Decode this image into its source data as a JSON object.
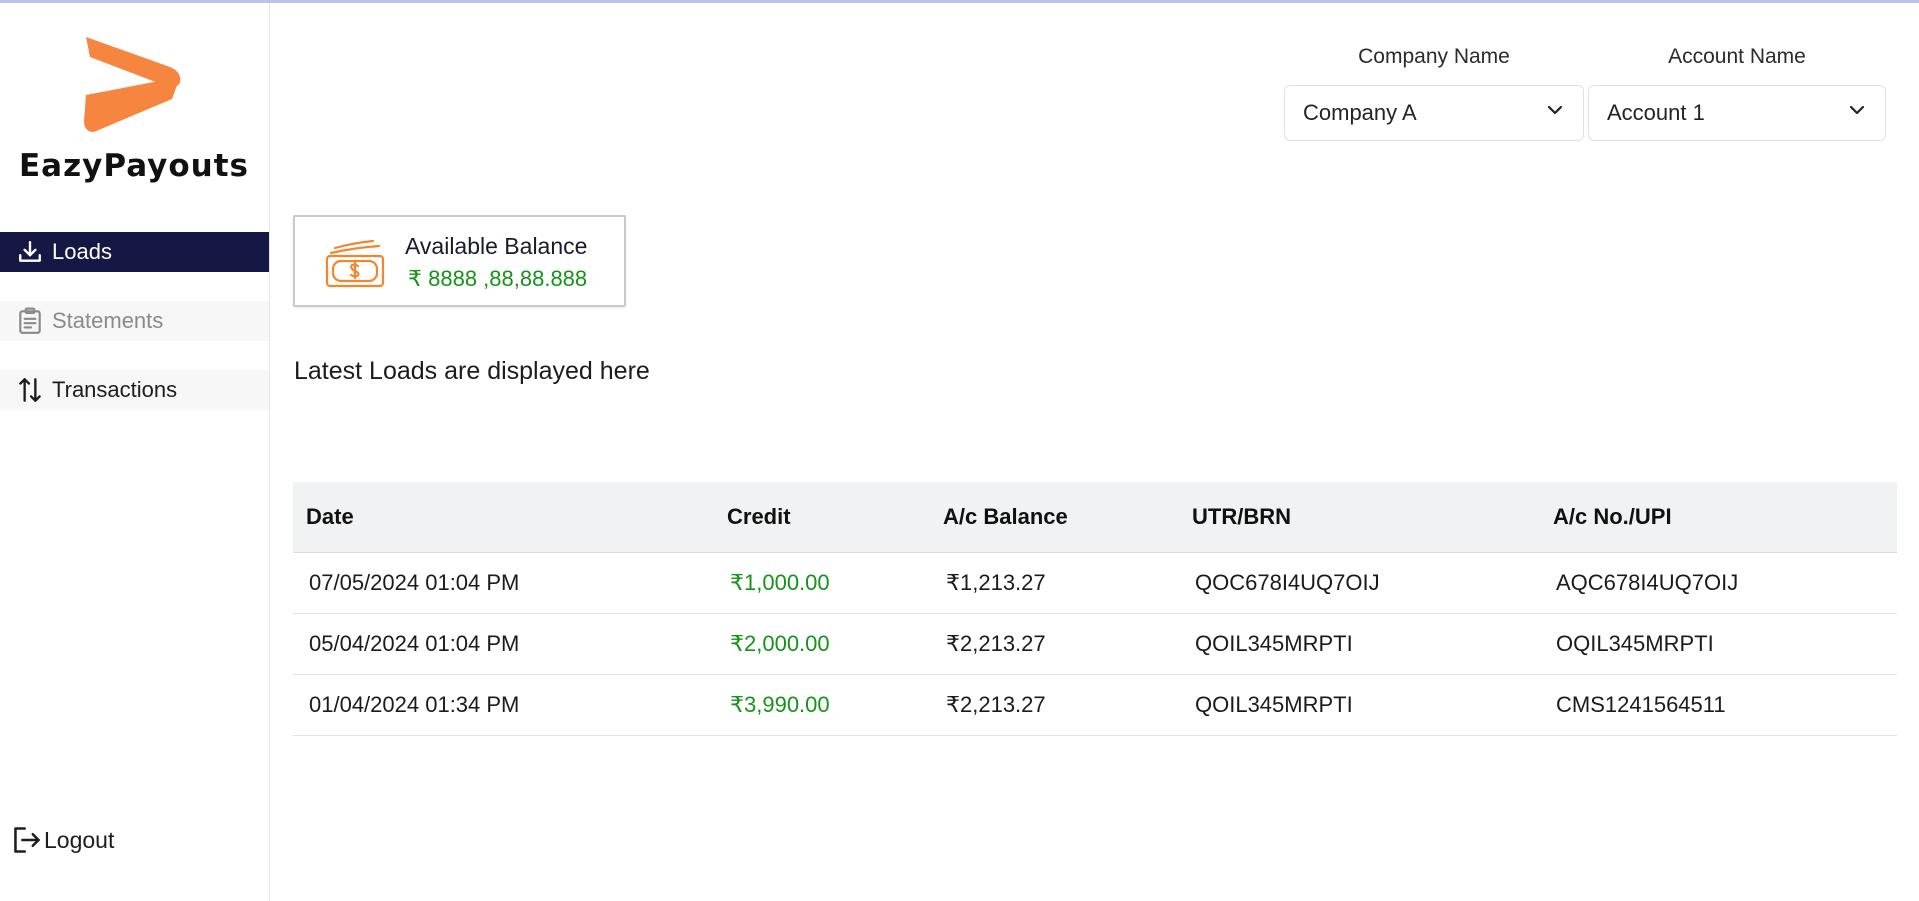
{
  "brand": {
    "name": "EazyPayouts",
    "accent_color": "#f5853f"
  },
  "sidebar": {
    "items": [
      {
        "label": "Loads",
        "icon": "download-icon",
        "active": true
      },
      {
        "label": "Statements",
        "icon": "clipboard-icon",
        "active": false
      },
      {
        "label": "Transactions",
        "icon": "arrows-up-down-icon",
        "active": false
      }
    ],
    "logout": {
      "label": "Logout",
      "icon": "logout-icon"
    }
  },
  "header": {
    "company": {
      "label": "Company Name",
      "value": "Company A"
    },
    "account": {
      "label": "Account Name",
      "value": "Account 1"
    }
  },
  "balance": {
    "title": "Available Balance",
    "value": "₹ 8888 ,88,88.888",
    "icon": "cash-icon"
  },
  "main": {
    "heading": "Latest Loads are displayed here"
  },
  "table": {
    "columns": [
      "Date",
      "Credit",
      "A/c Balance",
      "UTR/BRN",
      "A/c No./UPI"
    ],
    "rows": [
      {
        "date": "07/05/2024 01:04 PM",
        "credit": "₹1,000.00",
        "balance": "₹1,213.27",
        "utr": "QOC678I4UQ7OIJ",
        "account": "AQC678I4UQ7OIJ"
      },
      {
        "date": "05/04/2024 01:04 PM",
        "credit": "₹2,000.00",
        "balance": "₹2,213.27",
        "utr": "QOIL345MRPTI",
        "account": "OQIL345MRPTI"
      },
      {
        "date": "01/04/2024 01:34 PM",
        "credit": "₹3,990.00",
        "balance": "₹2,213.27",
        "utr": "QOIL345MRPTI",
        "account": "CMS1241564511"
      }
    ]
  },
  "colors": {
    "sidebar_active_bg": "#151845",
    "credit_green": "#15931b"
  }
}
